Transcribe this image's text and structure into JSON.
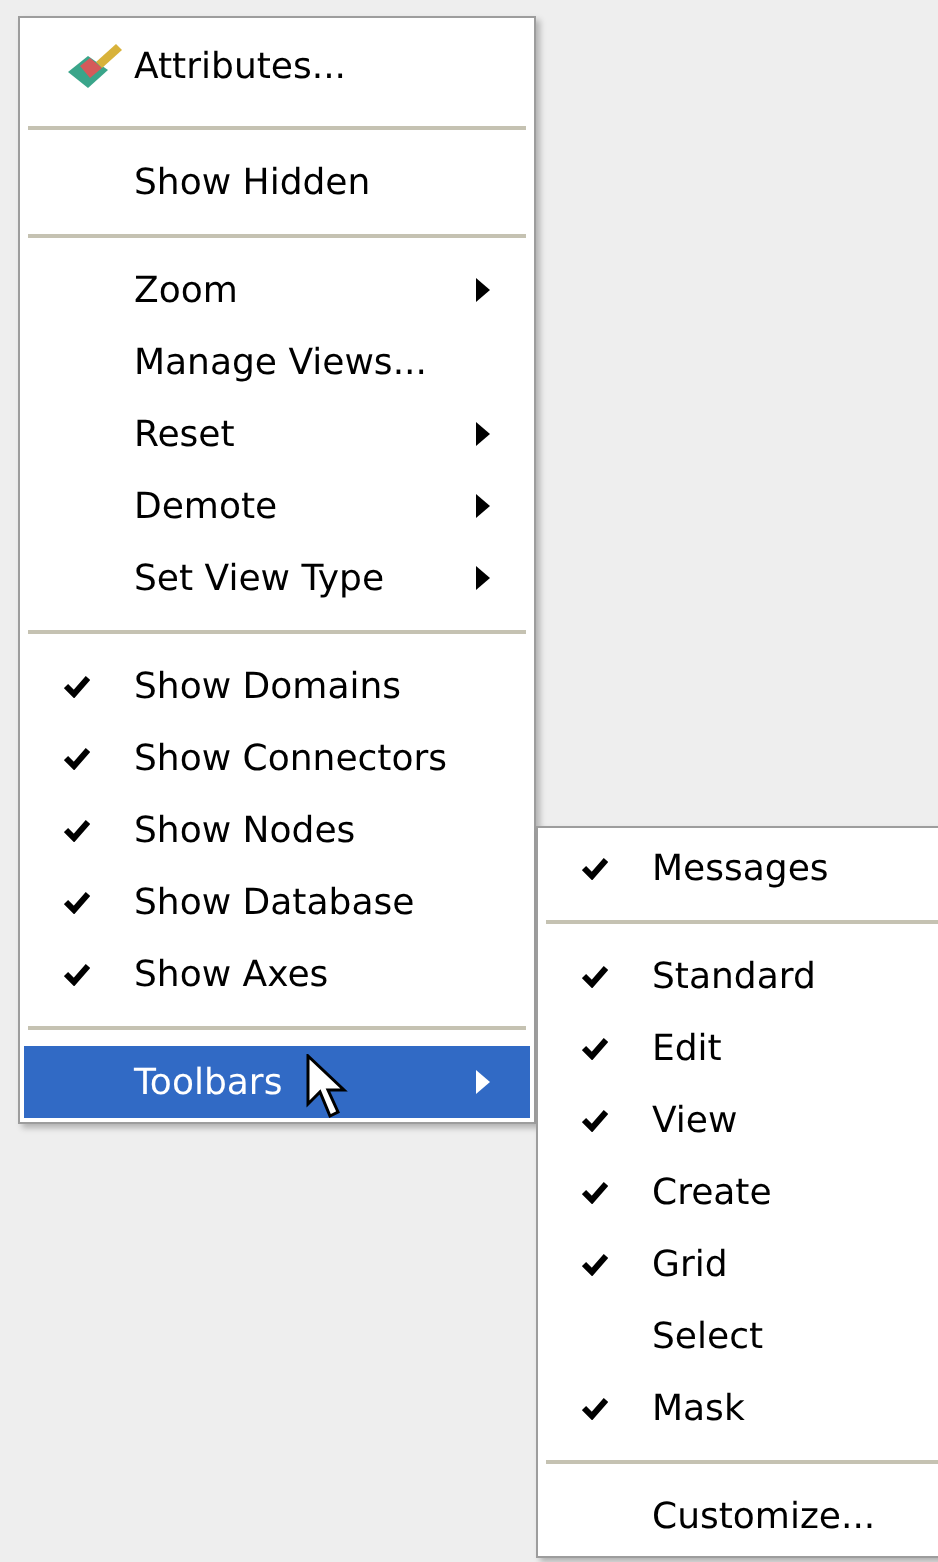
{
  "context_menu": {
    "items": [
      {
        "kind": "item",
        "label": "Attributes...",
        "icon": true,
        "checked": false,
        "has_submenu": false,
        "selected": false
      },
      {
        "kind": "separator"
      },
      {
        "kind": "item",
        "label": "Show Hidden",
        "icon": false,
        "checked": false,
        "has_submenu": false,
        "selected": false
      },
      {
        "kind": "separator"
      },
      {
        "kind": "item",
        "label": "Zoom",
        "icon": false,
        "checked": false,
        "has_submenu": true,
        "selected": false
      },
      {
        "kind": "item",
        "label": "Manage Views...",
        "icon": false,
        "checked": false,
        "has_submenu": false,
        "selected": false
      },
      {
        "kind": "item",
        "label": "Reset",
        "icon": false,
        "checked": false,
        "has_submenu": true,
        "selected": false
      },
      {
        "kind": "item",
        "label": "Demote",
        "icon": false,
        "checked": false,
        "has_submenu": true,
        "selected": false
      },
      {
        "kind": "item",
        "label": "Set View Type",
        "icon": false,
        "checked": false,
        "has_submenu": true,
        "selected": false
      },
      {
        "kind": "separator"
      },
      {
        "kind": "item",
        "label": "Show Domains",
        "icon": false,
        "checked": true,
        "has_submenu": false,
        "selected": false
      },
      {
        "kind": "item",
        "label": "Show Connectors",
        "icon": false,
        "checked": true,
        "has_submenu": false,
        "selected": false
      },
      {
        "kind": "item",
        "label": "Show Nodes",
        "icon": false,
        "checked": true,
        "has_submenu": false,
        "selected": false
      },
      {
        "kind": "item",
        "label": "Show Database",
        "icon": false,
        "checked": true,
        "has_submenu": false,
        "selected": false
      },
      {
        "kind": "item",
        "label": "Show Axes",
        "icon": false,
        "checked": true,
        "has_submenu": false,
        "selected": false
      },
      {
        "kind": "separator"
      },
      {
        "kind": "item",
        "label": "Toolbars",
        "icon": false,
        "checked": false,
        "has_submenu": true,
        "selected": true
      }
    ]
  },
  "toolbars_submenu": {
    "items": [
      {
        "kind": "item",
        "label": "Messages",
        "checked": true,
        "selected": false
      },
      {
        "kind": "separator"
      },
      {
        "kind": "item",
        "label": "Standard",
        "checked": true,
        "selected": false
      },
      {
        "kind": "item",
        "label": "Edit",
        "checked": true,
        "selected": false
      },
      {
        "kind": "item",
        "label": "View",
        "checked": true,
        "selected": false
      },
      {
        "kind": "item",
        "label": "Create",
        "checked": true,
        "selected": false
      },
      {
        "kind": "item",
        "label": "Grid",
        "checked": true,
        "selected": false
      },
      {
        "kind": "item",
        "label": "Select",
        "checked": false,
        "selected": false
      },
      {
        "kind": "item",
        "label": "Mask",
        "checked": true,
        "selected": false
      },
      {
        "kind": "separator"
      },
      {
        "kind": "item",
        "label": "Customize...",
        "checked": false,
        "selected": false
      }
    ]
  }
}
